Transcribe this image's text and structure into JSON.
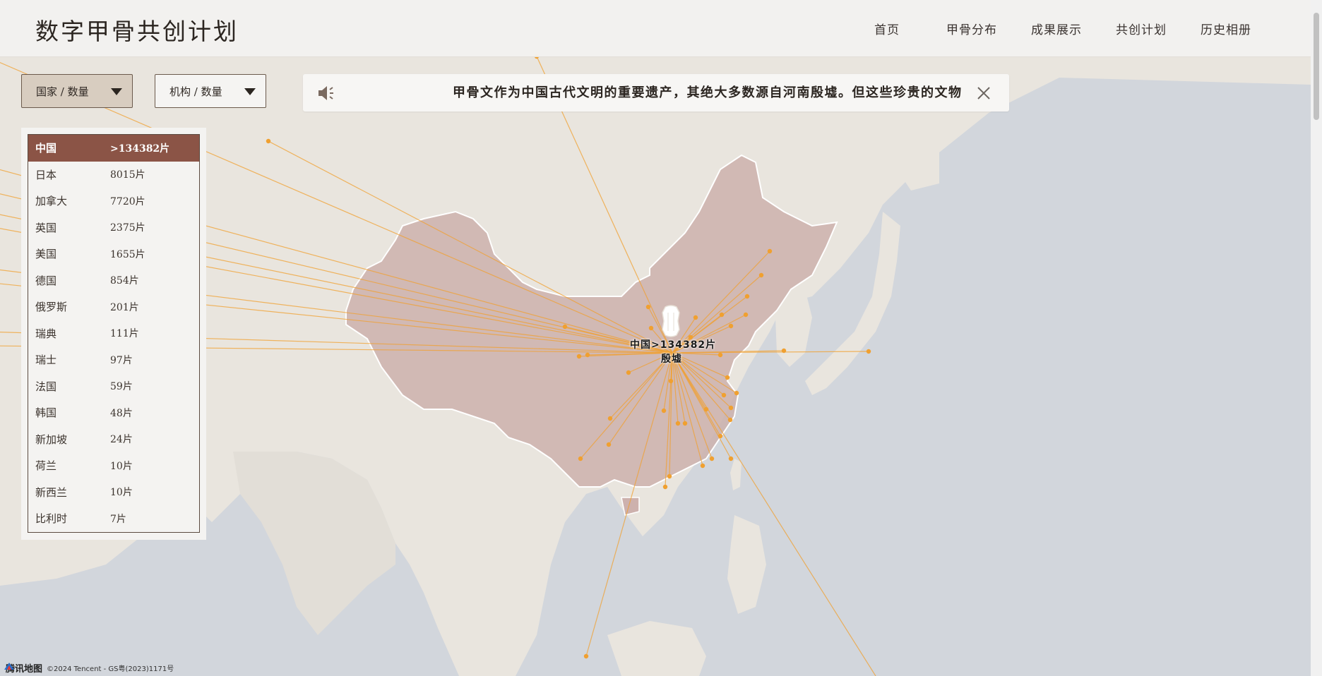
{
  "header": {
    "site_title": "数字甲骨共创计划",
    "nav": [
      "首页",
      "甲骨分布",
      "成果展示",
      "共创计划",
      "历史相册"
    ]
  },
  "filters": {
    "country_select": "国家 / 数量",
    "institution_select": "机构 / 数量"
  },
  "notice": {
    "text": "甲骨文作为中国古代文明的重要遗产，其绝大多数源自河南殷墟。但这些珍贵的文物"
  },
  "country_list": [
    {
      "country": "中国",
      "count": ">134382片"
    },
    {
      "country": "日本",
      "count": "8015片"
    },
    {
      "country": "加拿大",
      "count": "7720片"
    },
    {
      "country": "英国",
      "count": "2375片"
    },
    {
      "country": "美国",
      "count": "1655片"
    },
    {
      "country": "德国",
      "count": "854片"
    },
    {
      "country": "俄罗斯",
      "count": "201片"
    },
    {
      "country": "瑞典",
      "count": "111片"
    },
    {
      "country": "瑞士",
      "count": "97片"
    },
    {
      "country": "法国",
      "count": "59片"
    },
    {
      "country": "韩国",
      "count": "48片"
    },
    {
      "country": "新加坡",
      "count": "24片"
    },
    {
      "country": "荷兰",
      "count": "10片"
    },
    {
      "country": "新西兰",
      "count": "10片"
    },
    {
      "country": "比利时",
      "count": "7片"
    }
  ],
  "map": {
    "marker_label": "中国>134382片",
    "origin_label": "殷墟",
    "provider": "腾讯地图",
    "copyright": "©2024 Tencent - GS粤(2023)1171号",
    "colors": {
      "flow_line": "#f0a030",
      "china_fill": "#cdb1ad",
      "land": "#e9e5de",
      "sea": "#d2d6dc",
      "active_row": "#8b5446"
    }
  }
}
